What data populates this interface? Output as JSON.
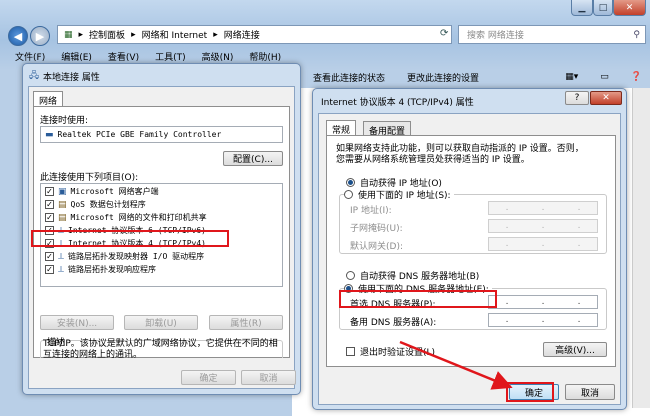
{
  "explorer": {
    "address_parts": [
      "控制面板",
      "网络和 Internet",
      "网络连接"
    ],
    "search_placeholder": "搜索 网络连接",
    "menu": [
      "文件(F)",
      "编辑(E)",
      "查看(V)",
      "工具(T)",
      "高级(N)",
      "帮助(H)"
    ],
    "toolbar": [
      "查看此连接的状态",
      "更改此连接的设置"
    ]
  },
  "local_dialog": {
    "title": "本地连接 属性",
    "tab": "网络",
    "connect_using_label": "连接时使用:",
    "adapter": "Realtek PCIe GBE Family Controller",
    "configure_button": "配置(C)...",
    "items_label": "此连接使用下列项目(O):",
    "items": [
      {
        "label": "Microsoft 网络客户端",
        "checked": true
      },
      {
        "label": "QoS 数据包计划程序",
        "checked": true
      },
      {
        "label": "Microsoft 网络的文件和打印机共享",
        "checked": true
      },
      {
        "label": "Internet 协议版本 6 (TCP/IPv6)",
        "checked": true
      },
      {
        "label": "Internet 协议版本 4 (TCP/IPv4)",
        "checked": true
      },
      {
        "label": "链路层拓扑发现映射器 I/O 驱动程序",
        "checked": true
      },
      {
        "label": "链路层拓扑发现响应程序",
        "checked": true
      }
    ],
    "install_button": "安装(N)...",
    "uninstall_button": "卸载(U)",
    "properties_button": "属性(R)",
    "description_title": "描述",
    "description_text": "TCP/IP。该协议是默认的广域网络协议，它提供在不同的相互连接的网络上的通讯。",
    "ok_button": "确定",
    "cancel_button": "取消"
  },
  "ipv4_dialog": {
    "title": "Internet 协议版本 4 (TCP/IPv4) 属性",
    "tabs": [
      "常规",
      "备用配置"
    ],
    "info_text_1": "如果网络支持此功能，则可以获取自动指派的 IP 设置。否则，",
    "info_text_2": "您需要从网络系统管理员处获得适当的 IP 设置。",
    "auto_ip": "自动获得 IP 地址(O)",
    "manual_ip": "使用下面的 IP 地址(S):",
    "ip_label": "IP 地址(I):",
    "mask_label": "子网掩码(U):",
    "gateway_label": "默认网关(D):",
    "auto_dns": "自动获得 DNS 服务器地址(B)",
    "manual_dns": "使用下面的 DNS 服务器地址(E):",
    "preferred_dns_label": "首选 DNS 服务器(P):",
    "alternate_dns_label": "备用 DNS 服务器(A):",
    "validate_label": "退出时验证设置(L)",
    "advanced_button": "高级(V)...",
    "ok_button": "确定",
    "cancel_button": "取消",
    "help_button": "?",
    "close_button": "✕",
    "selected_ip_mode": "auto",
    "selected_dns_mode": "manual"
  }
}
